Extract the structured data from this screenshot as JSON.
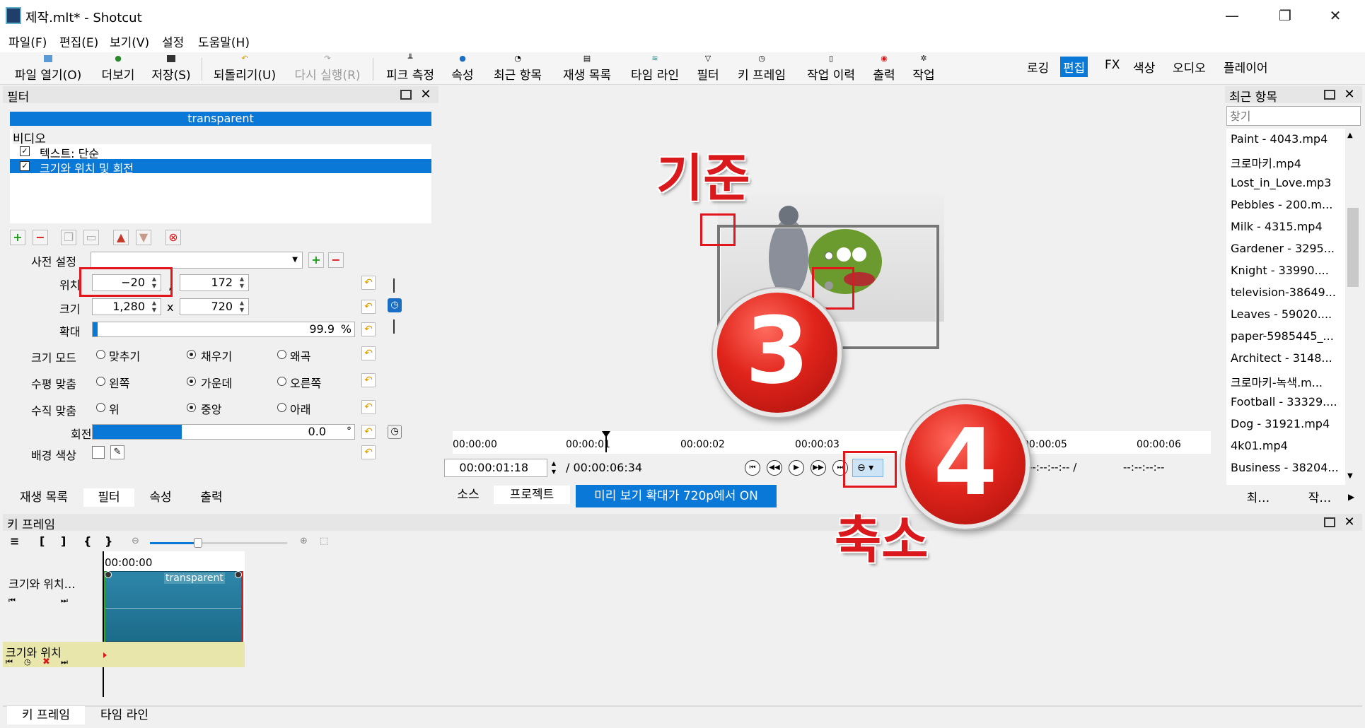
{
  "window": {
    "title": "제작.mlt* - Shotcut",
    "minimize": "—",
    "restore": "❐",
    "close": "✕"
  },
  "menu": [
    "파일(F)",
    "편집(E)",
    "보기(V)",
    "설정",
    "도움말(H)"
  ],
  "toolbar": {
    "items": [
      "파일 열기(O)",
      "더보기",
      "저장(S)",
      "되돌리기(U)",
      "다시 실행(R)",
      "피크 측정",
      "속성",
      "최근 항목",
      "재생 목록",
      "타임 라인",
      "필터",
      "키 프레임",
      "작업 이력",
      "출력",
      "작업"
    ],
    "layouts": [
      "로깅",
      "편집",
      "FX",
      "색상",
      "오디오",
      "플레이어"
    ],
    "active_layout": "편집"
  },
  "filters_panel": {
    "title": "필터",
    "clip_name": "transparent",
    "category": "비디오",
    "filters": [
      {
        "label": "텍스트: 단순",
        "checked": true
      },
      {
        "label": "크기와 위치 및 회전",
        "checked": true
      }
    ],
    "preset_label": "사전 설정",
    "position_label": "위치",
    "position_x": "−20",
    "position_sep": ",",
    "position_y": "172",
    "size_label": "크기",
    "size_w": "1,280",
    "size_x": "x",
    "size_h": "720",
    "zoom_label": "확대",
    "zoom_value": "99.9",
    "zoom_unit": "%",
    "zoom_fraction": 0.02,
    "size_mode_label": "크기 모드",
    "size_mode_options": [
      "맞추기",
      "채우기",
      "왜곡"
    ],
    "size_mode_selected": 1,
    "h_align_label": "수평 맞춤",
    "h_align_options": [
      "왼쪽",
      "가운데",
      "오른쪽"
    ],
    "h_align_selected": 1,
    "v_align_label": "수직 맞춤",
    "v_align_options": [
      "위",
      "중앙",
      "아래"
    ],
    "v_align_selected": 1,
    "rotation_label": "회전",
    "rotation_value": "0.0",
    "rotation_unit": "°",
    "bg_color_label": "배경 색상"
  },
  "left_tabs": [
    "재생 목록",
    "필터",
    "속성",
    "출력"
  ],
  "left_tab_active": "필터",
  "player": {
    "ruler": [
      "00:00:00",
      "00:00:01",
      "00:00:02",
      "00:00:03",
      "00:00:05",
      "00:00:06"
    ],
    "current_time": "00:00:01:18",
    "duration": "/ 00:00:06:34",
    "in_point": "--:--:--:-- /",
    "out_point": "--:--:--:--",
    "tabs": [
      "소스",
      "프로젝트"
    ],
    "active_tab": "프로젝트",
    "notice": "미리 보기 확대가 720p에서 ON"
  },
  "recent": {
    "title": "최근 항목",
    "search_placeholder": "찾기",
    "items": [
      "Paint - 4043.mp4",
      "크로마키.mp4",
      "Lost_in_Love.mp3",
      "Pebbles - 200.m...",
      "Milk - 4315.mp4",
      "Gardener - 3295...",
      "Knight - 33990....",
      "television-38649...",
      "Leaves - 59020....",
      "paper-5985445_...",
      "Architect - 3148...",
      "크로마키-녹색.m...",
      "Football - 33329....",
      "Dog - 31921.mp4",
      "4k01.mp4",
      "Business - 38204..."
    ],
    "tabs": [
      "최…",
      "작…"
    ]
  },
  "keyframes": {
    "title": "키 프레임",
    "toolbar_glyphs": [
      "≡",
      "[",
      "]",
      "{",
      "}"
    ],
    "time": "00:00:00",
    "track_label": "크기와 위치…",
    "clip_label": "transparent",
    "param_label": "크기와 위치"
  },
  "bottom_tabs": [
    "키 프레임",
    "타임 라인"
  ],
  "bottom_tab_active": "키 프레임",
  "annotations": {
    "label_origin": "기준",
    "badge3": "3",
    "badge4": "4",
    "label_zoom_out": "축소",
    "color": "#e3171b"
  }
}
